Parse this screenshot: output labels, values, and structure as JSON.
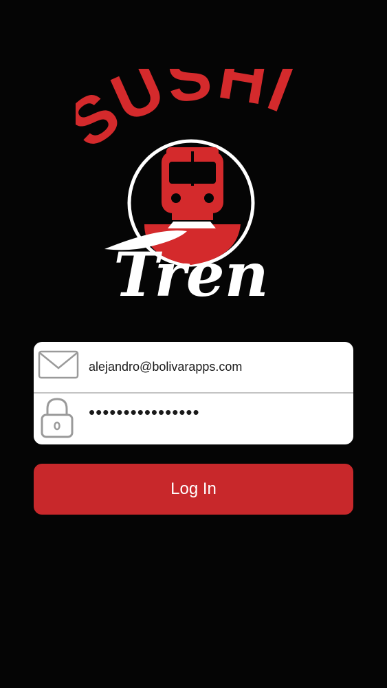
{
  "brand": {
    "logo_word_top": "SUSHI",
    "logo_word_bottom": "Tren",
    "logo_red": "#d42a2c",
    "logo_white": "#ffffff"
  },
  "form": {
    "email": {
      "icon": "envelope-icon",
      "value": "alejandro@bolivarapps.com"
    },
    "password": {
      "icon": "padlock-icon",
      "value": "••••••••••••••••"
    }
  },
  "actions": {
    "login_label": "Log In",
    "login_color": "#c8282b"
  }
}
